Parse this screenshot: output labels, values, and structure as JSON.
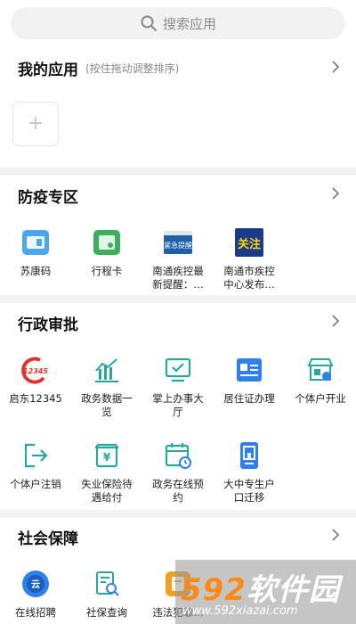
{
  "search": {
    "placeholder": "搜索应用"
  },
  "my_apps": {
    "title": "我的应用",
    "hint": "(按住拖动调整排序)",
    "add_label": "+"
  },
  "epidemic": {
    "title": "防疫专区",
    "items": [
      {
        "label": "苏康码",
        "icon": "health-code-icon"
      },
      {
        "label": "行程卡",
        "icon": "itinerary-card-icon"
      },
      {
        "label": "南通疾控最\n新提醒：…",
        "icon": "urgent-notice-icon",
        "icon_text": "紧急提醒"
      },
      {
        "label": "南通市疾控\n中心发布…",
        "icon": "attention-icon",
        "icon_text": "关注"
      }
    ]
  },
  "admin": {
    "title": "行政审批",
    "items": [
      {
        "label": "启东12345",
        "icon": "hotline-12345-icon",
        "icon_text": "12345"
      },
      {
        "label": "政务数据一\n览",
        "icon": "bar-chart-icon"
      },
      {
        "label": "掌上办事大\n厅",
        "icon": "monitor-check-icon"
      },
      {
        "label": "居住证办理",
        "icon": "id-card-icon"
      },
      {
        "label": "个体户开业",
        "icon": "store-icon"
      },
      {
        "label": "个体户注销",
        "icon": "logout-icon"
      },
      {
        "label": "失业保险待\n遇给付",
        "icon": "yuan-wallet-icon",
        "icon_text": "¥"
      },
      {
        "label": "政务在线预\n约",
        "icon": "calendar-clock-icon"
      },
      {
        "label": "大中专生户\n口迁移",
        "icon": "household-transfer-icon"
      }
    ]
  },
  "social": {
    "title": "社会保障",
    "items": [
      {
        "label": "在线招聘",
        "icon": "cloud-recruit-icon",
        "icon_text": "云"
      },
      {
        "label": "社保查询",
        "icon": "social-security-query-icon"
      },
      {
        "label": "违法犯罪…",
        "icon": "report-icon"
      }
    ]
  },
  "watermark": {
    "main_prefix": "",
    "main_num": "592",
    "main_suffix": "软件园",
    "sub": "www.592xiazai.com"
  },
  "colors": {
    "accent_blue": "#2f80ed",
    "teal": "#2aa79b",
    "green": "#3cae5c",
    "orange": "#f0a020",
    "red": "#e0322e",
    "navy": "#1a3a8a"
  }
}
